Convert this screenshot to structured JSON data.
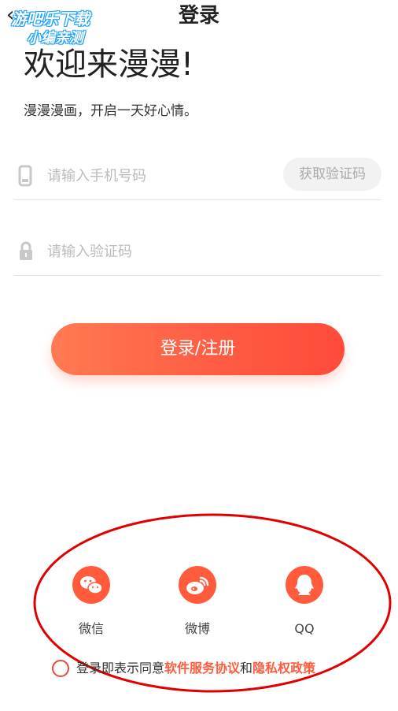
{
  "header": {
    "back_symbol": "‹",
    "title": "登录"
  },
  "watermark": {
    "line1": "游吧乐下载",
    "line2": "小编亲测"
  },
  "welcome": {
    "heading": "欢迎来漫漫!",
    "subtitle": "漫漫漫画，开启一天好心情。"
  },
  "phone": {
    "icon": "phone-icon",
    "placeholder": "请输入手机号码",
    "get_code_label": "获取验证码"
  },
  "code": {
    "icon": "lock-icon",
    "placeholder": "请输入验证码"
  },
  "login_button_label": "登录/注册",
  "social": [
    {
      "icon": "wechat-icon",
      "label": "微信"
    },
    {
      "icon": "weibo-icon",
      "label": "微博"
    },
    {
      "icon": "qq-icon",
      "label": "QQ"
    }
  ],
  "agreement": {
    "prefix": "登录即表示同意",
    "terms": "软件服务协议",
    "and": "和",
    "privacy": "隐私权政策"
  },
  "colors": {
    "accent": "#ff5b3c",
    "annotation": "#e00000"
  }
}
